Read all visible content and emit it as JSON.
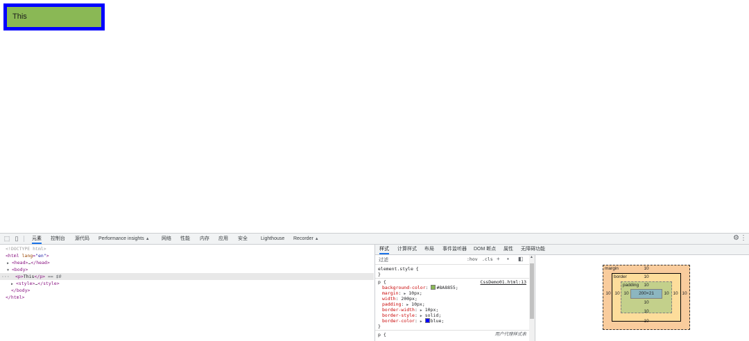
{
  "page": {
    "paragraph_text": "This"
  },
  "colors": {
    "paragraph_bg": "#8AB855",
    "paragraph_border": "#0000ff",
    "devtools_accent": "#1a73e8"
  },
  "devtools": {
    "tabs": [
      "元素",
      "控制台",
      "源代码",
      "Performance insights",
      "网络",
      "性能",
      "内存",
      "应用",
      "安全",
      "Lighthouse",
      "Recorder"
    ],
    "active_tab": "元素",
    "elements_tree": {
      "doctype": "<!DOCTYPE html>",
      "html_open_tag": "html",
      "html_attr_name": "lang",
      "html_attr_value": "\"en\"",
      "head": "head",
      "head_ellipsis": "…",
      "body_open": "body",
      "p_tag": "p",
      "p_text": "This",
      "selected_marker": "== $0",
      "style_tag": "style",
      "style_ellipsis": "…",
      "body_close": "</body>",
      "html_close": "</html>"
    },
    "style_tabs": [
      "样式",
      "计算样式",
      "布局",
      "事件监听器",
      "DOM 断点",
      "属性",
      "无障碍功能"
    ],
    "active_style_tab": "样式",
    "filter_placeholder": "过滤",
    "hov_label": ":hov",
    "cls_label": ".cls",
    "element_style": "element.style {",
    "close_brace": "}",
    "rule_selector": "p {",
    "rule_source": "CssDemo01.html:13",
    "declarations": [
      {
        "prop": "background-color",
        "value": "#8A8855",
        "has_swatch": true,
        "swatch_color": "#8AB855",
        "expand": false
      },
      {
        "prop": "margin",
        "value": "10px",
        "expand": true
      },
      {
        "prop": "width",
        "value": "200px",
        "expand": false
      },
      {
        "prop": "padding",
        "value": "10px",
        "expand": true
      },
      {
        "prop": "border-width",
        "value": "10px",
        "expand": true
      },
      {
        "prop": "border-style",
        "value": "solid",
        "expand": true
      },
      {
        "prop": "border-color",
        "value": "blue",
        "has_swatch": true,
        "swatch_color": "#0000ff",
        "expand": true
      }
    ],
    "ua_selector": "p {",
    "ua_label": "用户代理样式表",
    "box_model": {
      "margin_label": "margin",
      "border_label": "border",
      "padding_label": "padding",
      "margin_top": "10",
      "margin_right": "10",
      "margin_bottom": "10",
      "margin_left": "10",
      "border_top": "10",
      "border_right": "10",
      "border_bottom": "10",
      "border_left": "10",
      "padding_top": "10",
      "padding_right": "10",
      "padding_bottom": "10",
      "padding_left": "10",
      "content": "200×21"
    }
  }
}
